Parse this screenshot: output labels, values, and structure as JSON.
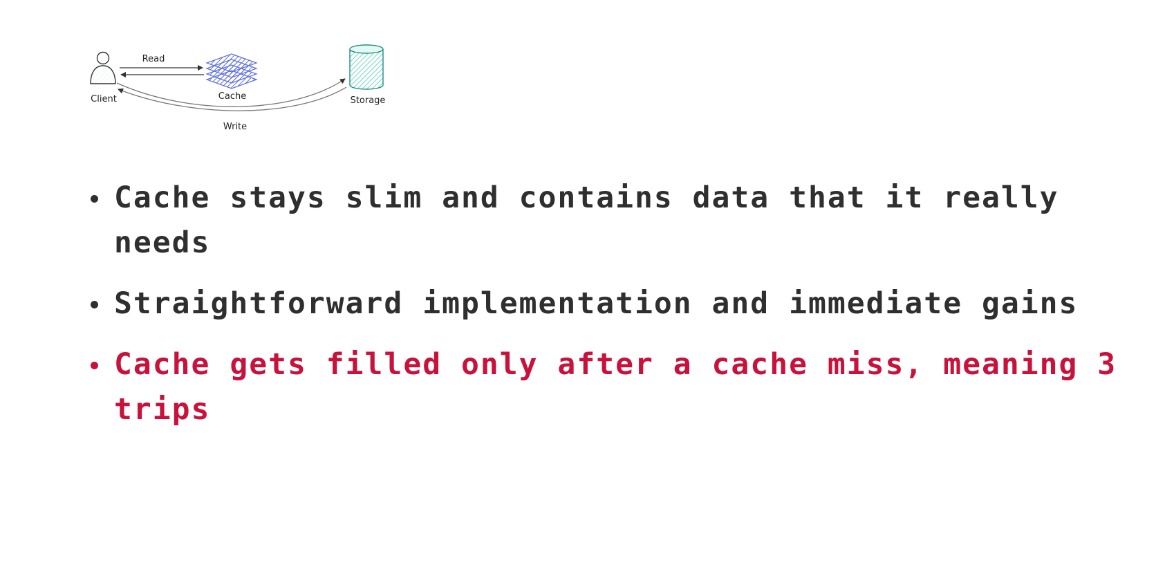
{
  "colors": {
    "text": "#2f2f2f",
    "highlight": "#c8113b",
    "cache_fill": "#5c6ee0",
    "storage_fill": "#6fd6c6"
  },
  "diagram": {
    "nodes": {
      "client": {
        "label": "Client",
        "icon": "person-icon"
      },
      "cache": {
        "label": "Cache",
        "icon": "layers-icon"
      },
      "storage": {
        "label": "Storage",
        "icon": "database-icon"
      }
    },
    "edges": {
      "read": {
        "label": "Read"
      },
      "write": {
        "label": "Write"
      }
    }
  },
  "bullets": [
    {
      "text": "Cache stays slim and contains data that it really needs",
      "highlight": false
    },
    {
      "text": "Straightforward implementation and immediate gains",
      "highlight": false
    },
    {
      "text": "Cache gets filled only after a cache miss, meaning 3 trips",
      "highlight": true
    }
  ]
}
